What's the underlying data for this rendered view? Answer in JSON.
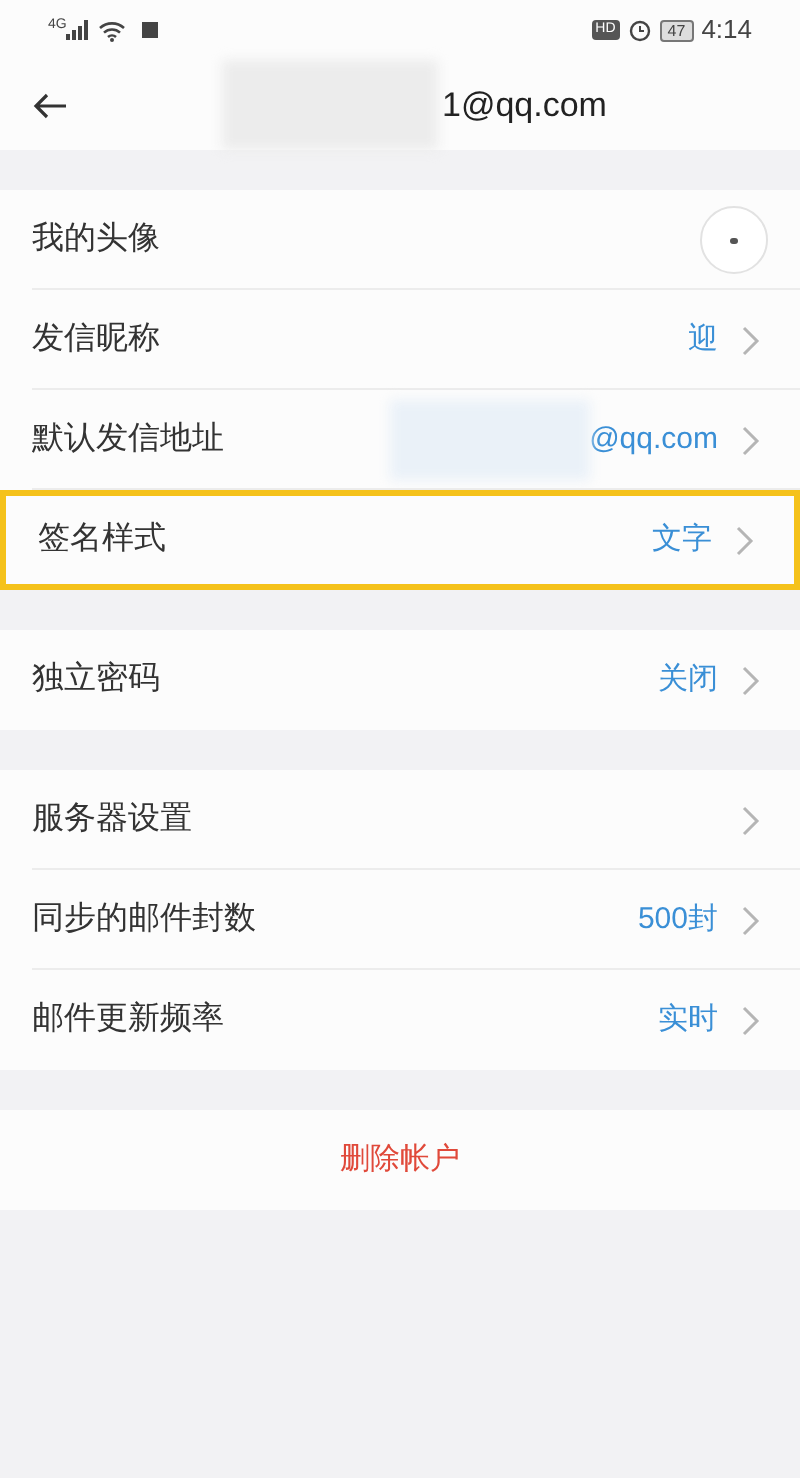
{
  "status_bar": {
    "network": "4G",
    "hd": "HD",
    "battery": "47",
    "time": "4:14"
  },
  "header": {
    "title": "1@qq.com"
  },
  "sections": [
    {
      "rows": [
        {
          "kind": "avatar",
          "label": "我的头像",
          "highlighted": false
        },
        {
          "kind": "value",
          "label": "发信昵称",
          "value": "迎",
          "highlighted": false
        },
        {
          "kind": "value",
          "label": "默认发信地址",
          "value": "@qq.com",
          "blurred": true,
          "highlighted": false
        },
        {
          "kind": "value",
          "label": "签名样式",
          "value": "文字",
          "highlighted": true
        }
      ]
    },
    {
      "rows": [
        {
          "kind": "value",
          "label": "独立密码",
          "value": "关闭",
          "highlighted": false
        }
      ]
    },
    {
      "rows": [
        {
          "kind": "value",
          "label": "服务器设置",
          "highlighted": false
        },
        {
          "kind": "value",
          "label": "同步的邮件封数",
          "value": "500封",
          "highlighted": false
        },
        {
          "kind": "value",
          "label": "邮件更新频率",
          "value": "实时",
          "highlighted": false
        }
      ]
    }
  ],
  "delete_button": {
    "label": "删除帐户"
  }
}
